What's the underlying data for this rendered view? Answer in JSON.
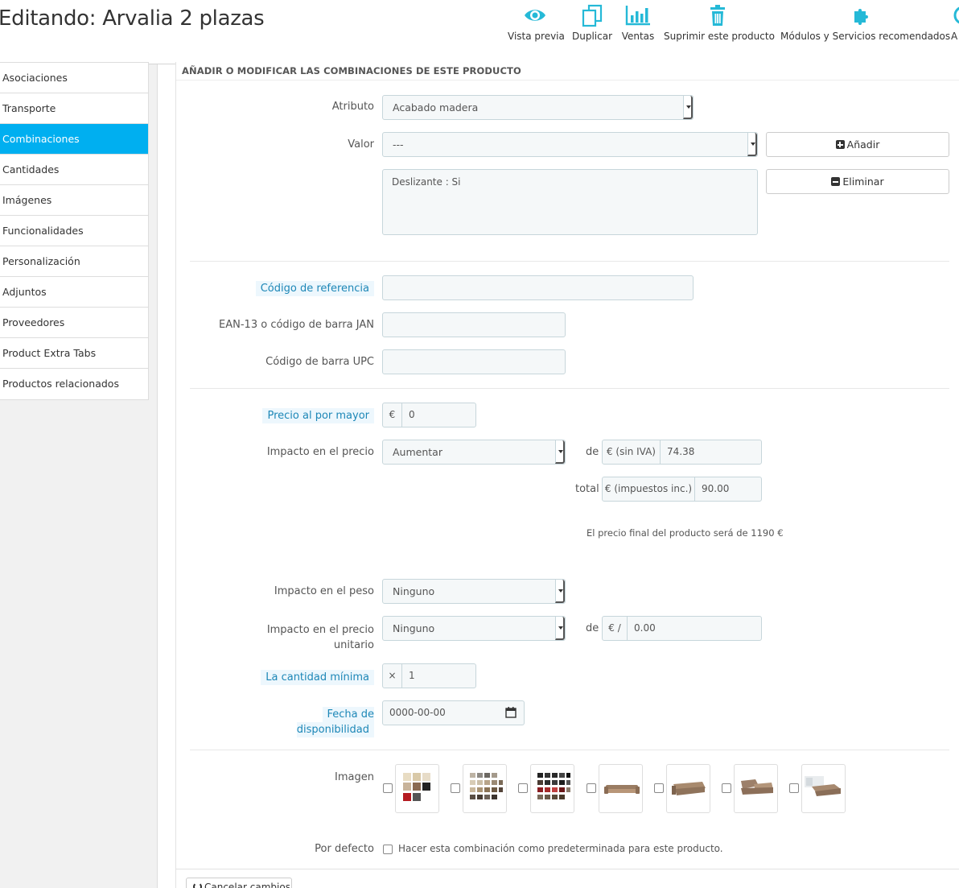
{
  "header": {
    "title": "Editando: Arvalia 2 plazas",
    "toolbar": [
      {
        "label": "Vista previa",
        "icon": "eye-icon"
      },
      {
        "label": "Duplicar",
        "icon": "duplicate-icon"
      },
      {
        "label": "Ventas",
        "icon": "bar-chart-icon"
      },
      {
        "label": "Suprimir este producto",
        "icon": "trash-icon"
      },
      {
        "label": "Módulos y Servicios recomendados",
        "icon": "puzzle-icon"
      },
      {
        "label": "A",
        "icon": "help-icon"
      }
    ],
    "accent_color": "#25b9d7"
  },
  "sidebar": {
    "items": [
      {
        "label": "Asociaciones"
      },
      {
        "label": "Transporte"
      },
      {
        "label": "Combinaciones"
      },
      {
        "label": "Cantidades"
      },
      {
        "label": "Imágenes"
      },
      {
        "label": "Funcionalidades"
      },
      {
        "label": "Personalización"
      },
      {
        "label": "Adjuntos"
      },
      {
        "label": "Proveedores"
      },
      {
        "label": "Product Extra Tabs"
      },
      {
        "label": "Productos relacionados"
      }
    ],
    "active_color": "#00aff0"
  },
  "panel": {
    "heading": "Añadir o modificar las combinaciones de este producto",
    "attribute": {
      "label": "Atributo",
      "value": "Acabado madera"
    },
    "valor": {
      "label": "Valor",
      "value": "---"
    },
    "add_button": "Añadir",
    "delete_button": "Eliminar",
    "selected_combinations": "Deslizante : Si",
    "reference": {
      "label": "Código de referencia",
      "value": ""
    },
    "ean": {
      "label": "EAN-13 o código de barra JAN",
      "value": ""
    },
    "upc": {
      "label": "Código de barra UPC",
      "value": ""
    },
    "wholesale": {
      "label": "Precio al por mayor",
      "currency": "€",
      "value": "0"
    },
    "price_impact": {
      "label": "Impacto en el precio",
      "value": "Aumentar",
      "de": "de",
      "tax_excl_addon": "€ (sin IVA)",
      "tax_excl_value": "74.38",
      "total": "total",
      "tax_incl_addon": "€ (impuestos inc.)",
      "tax_incl_value": "90.00"
    },
    "final_price_note": "El precio final del producto será de 1190 €",
    "weight_impact": {
      "label": "Impacto en el peso",
      "value": "Ninguno"
    },
    "unit_price_impact": {
      "label": "Impacto en el precio unitario",
      "value": "Ninguno",
      "de": "de",
      "addon": "€ /",
      "amount": "0.00"
    },
    "min_quantity": {
      "label": "La cantidad mínima",
      "addon": "×",
      "value": "1"
    },
    "availability": {
      "label": "Fecha de disponibilidad",
      "value": "0000-00-00"
    },
    "images": {
      "label": "Imagen",
      "count": 7
    },
    "default": {
      "label": "Por defecto",
      "text": "Hacer esta combinación como predeterminada para este producto."
    },
    "cancel_button": "Cancelar cambios"
  }
}
